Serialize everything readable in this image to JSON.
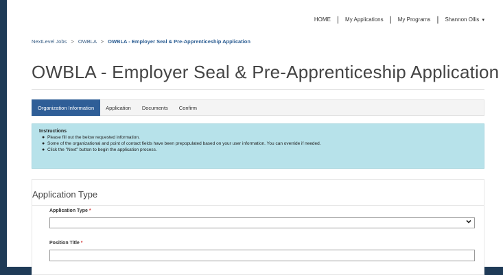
{
  "nav": {
    "home": "HOME",
    "my_applications": "My Applications",
    "my_programs": "My Programs",
    "user_name": "Shannon Ollis",
    "caret": "▾"
  },
  "breadcrumb": {
    "item1": "NextLevel Jobs",
    "item2": "OWBLA",
    "current": "OWBLA - Employer Seal & Pre-Apprenticeship Application",
    "separator": ">"
  },
  "page": {
    "title": "OWBLA - Employer Seal & Pre-Apprenticeship Application"
  },
  "tabs": [
    {
      "label": "Organization Information",
      "active": true
    },
    {
      "label": "Application",
      "active": false
    },
    {
      "label": "Documents",
      "active": false
    },
    {
      "label": "Confirm",
      "active": false
    }
  ],
  "instructions": {
    "heading": "Instructions",
    "items": [
      "Please fill out the below requested information.",
      "Some of the organizational and point of contact fields have been prepopulated based on your user information. You can override if needed.",
      "Click the \"Next\" button to begin the application process."
    ]
  },
  "section": {
    "title": "Application Type",
    "fields": {
      "application_type": {
        "label": "Application Type",
        "required_mark": "*",
        "value": ""
      },
      "position_title": {
        "label": "Position Title",
        "required_mark": "*",
        "value": ""
      }
    }
  },
  "colors": {
    "accent": "#2f5e97",
    "info_bg": "#b7e2ea",
    "outer_bg": "#1f3b57",
    "required": "#d43b3b"
  }
}
